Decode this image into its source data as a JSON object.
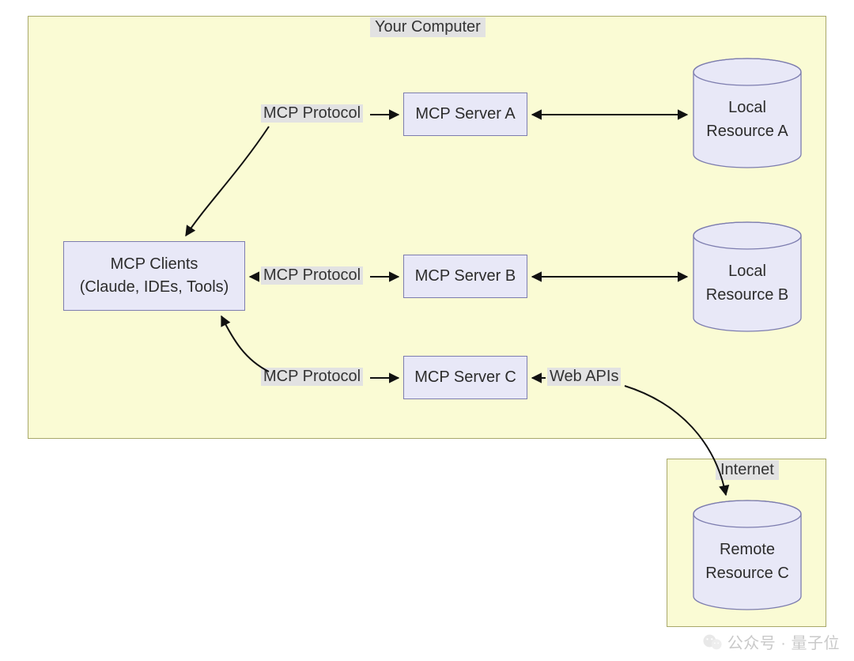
{
  "zones": {
    "computer": {
      "title": "Your Computer"
    },
    "internet": {
      "title": "Internet"
    }
  },
  "nodes": {
    "clients": {
      "line1": "MCP Clients",
      "line2": "(Claude, IDEs, Tools)"
    },
    "serverA": "MCP Server A",
    "serverB": "MCP Server B",
    "serverC": "MCP Server C",
    "localA": {
      "line1": "Local",
      "line2": "Resource A"
    },
    "localB": {
      "line1": "Local",
      "line2": "Resource B"
    },
    "remoteC": {
      "line1": "Remote",
      "line2": "Resource C"
    }
  },
  "edges": {
    "protoA": "MCP Protocol",
    "protoB": "MCP Protocol",
    "protoC": "MCP Protocol",
    "webapis": "Web APIs"
  },
  "watermark": {
    "text": "公众号 · 量子位"
  }
}
